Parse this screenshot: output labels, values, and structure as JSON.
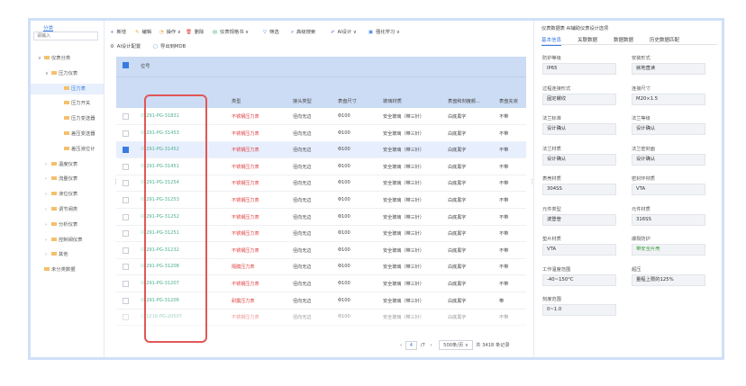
{
  "tree": {
    "title": "分类",
    "search_placeholder": "请输入",
    "items": [
      {
        "arrow": "∨",
        "label": "仪表分类"
      },
      {
        "arrow": "∨",
        "label": "压力仪表"
      },
      {
        "arrow": "",
        "label": "压力表"
      },
      {
        "arrow": "",
        "label": "压力开关"
      },
      {
        "arrow": "",
        "label": "压力变送器"
      },
      {
        "arrow": "",
        "label": "差压变送器"
      },
      {
        "arrow": "",
        "label": "差压液位计"
      },
      {
        "arrow": "›",
        "label": "温度仪表"
      },
      {
        "arrow": "›",
        "label": "流量仪表"
      },
      {
        "arrow": "›",
        "label": "液位仪表"
      },
      {
        "arrow": "›",
        "label": "调节阀类"
      },
      {
        "arrow": "›",
        "label": "分析仪表"
      },
      {
        "arrow": "›",
        "label": "控制阀仪表"
      },
      {
        "arrow": "›",
        "label": "其他"
      },
      {
        "arrow": "",
        "label": "未分类数据"
      }
    ]
  },
  "toolbar": {
    "row1": [
      {
        "icon": "+",
        "label": "新增",
        "color": "#3a7be0"
      },
      {
        "icon": "✎",
        "label": "编辑",
        "color": "#f0a020"
      },
      {
        "icon": "◔",
        "label": "操作 ∨",
        "color": "#f0a020"
      },
      {
        "icon": "🗑",
        "label": "删除",
        "color": "#e04040"
      },
      {
        "icon": "▤",
        "label": "仪表规格书 ∨",
        "color": "#3bb36b"
      },
      {
        "icon": "▽",
        "label": "筛选",
        "color": "#3a7be0"
      },
      {
        "icon": "⌕",
        "label": "高级搜索",
        "color": "#3a7be0"
      },
      {
        "icon": "✐",
        "label": "AI设计 ∨",
        "color": "#8a56e0"
      },
      {
        "icon": "▣",
        "label": "强化学习 ∨",
        "color": "#3a7be0"
      }
    ],
    "row2": [
      {
        "icon": "⚙",
        "label": "AI设计配置",
        "color": "#666"
      },
      {
        "icon": "▢",
        "label": "导出到MDB",
        "color": "#3a7be0"
      }
    ]
  },
  "table": {
    "headers": {
      "position": "位号",
      "type": "类型",
      "connection": "接头类型",
      "size": "表盘尺寸",
      "material": "玻璃材质",
      "dial": "表盘和刻度颜...",
      "case": "表盘充液"
    },
    "rows": [
      {
        "tag": "291-PG-31831",
        "type": "不锈钢压力表",
        "connection": "径向无边",
        "size": "Φ100",
        "material": "安全玻璃（带三针）",
        "dial": "白底黑字",
        "fill": "不带",
        "checked": false
      },
      {
        "tag": "291-PG-31453",
        "type": "不锈钢压力表",
        "connection": "径向无边",
        "size": "Φ100",
        "material": "安全玻璃（带三针）",
        "dial": "白底黑字",
        "fill": "不带",
        "checked": false
      },
      {
        "tag": "291-PG-31452",
        "type": "不锈钢压力表",
        "connection": "径向无边",
        "size": "Φ100",
        "material": "安全玻璃（带三针）",
        "dial": "白底黑字",
        "fill": "不带",
        "checked": true
      },
      {
        "tag": "291-PG-31451",
        "type": "不锈钢压力表",
        "connection": "径向无边",
        "size": "Φ100",
        "material": "安全玻璃（带三针）",
        "dial": "白底黑字",
        "fill": "不带",
        "checked": false
      },
      {
        "tag": "291-PG-31254",
        "type": "不锈钢压力表",
        "connection": "径向无边",
        "size": "Φ100",
        "material": "安全玻璃（带三针）",
        "dial": "白底黑字",
        "fill": "不带",
        "checked": false
      },
      {
        "tag": "291-PG-31253",
        "type": "不锈钢压力表",
        "connection": "径向无边",
        "size": "Φ100",
        "material": "安全玻璃（带三针）",
        "dial": "白底黑字",
        "fill": "不带",
        "checked": false
      },
      {
        "tag": "291-PG-31252",
        "type": "不锈钢压力表",
        "connection": "径向无边",
        "size": "Φ100",
        "material": "安全玻璃（带三针）",
        "dial": "白底黑字",
        "fill": "不带",
        "checked": false
      },
      {
        "tag": "291-PG-31251",
        "type": "不锈钢压力表",
        "connection": "径向无边",
        "size": "Φ100",
        "material": "安全玻璃（带三针）",
        "dial": "白底黑字",
        "fill": "不带",
        "checked": false
      },
      {
        "tag": "291-PG-31232",
        "type": "不锈钢压力表",
        "connection": "径向无边",
        "size": "Φ100",
        "material": "安全玻璃（带三针）",
        "dial": "白底黑字",
        "fill": "不带",
        "checked": false
      },
      {
        "tag": "291-PG-31208",
        "type": "隔膜压力表",
        "connection": "径向无边",
        "size": "Φ100",
        "material": "安全玻璃（带三针）",
        "dial": "白底黑字",
        "fill": "不带",
        "checked": false
      },
      {
        "tag": "291-PG-31207",
        "type": "不锈钢压力表",
        "connection": "径向无边",
        "size": "Φ100",
        "material": "安全玻璃（带三针）",
        "dial": "白底黑字",
        "fill": "不带",
        "checked": false
      },
      {
        "tag": "291-PG-31206",
        "type": "耐震压力表",
        "connection": "径向无边",
        "size": "Φ100",
        "material": "安全玻璃（带三针）",
        "dial": "白底黑字",
        "fill": "带",
        "checked": false
      },
      {
        "tag": "1216-PG-20507",
        "type": "不锈钢压力表",
        "connection": "径向无边",
        "size": "Φ100",
        "material": "安全玻璃（带三针）",
        "dial": "白底黑字",
        "fill": "不带",
        "checked": false
      }
    ]
  },
  "pager": {
    "prev": "‹",
    "page": "4",
    "total_pages": "/7",
    "next": "›",
    "page_size": "500条/页 ∨",
    "total": "共 3418 条记录"
  },
  "right": {
    "header": "仪表数据表 AI辅助仪表设计选项",
    "tabs": [
      "基本信息",
      "关联数据",
      "数据数据",
      "历史数据匹配"
    ],
    "fields": [
      {
        "label": "防护等级",
        "value": "IP65"
      },
      {
        "label": "安装形式",
        "value": "就地直读"
      },
      {
        "label": "过程连接形式",
        "value": "固定螺纹"
      },
      {
        "label": "连接尺寸",
        "value": "M20×1.5"
      },
      {
        "label": "法兰标准",
        "value": "设计确认"
      },
      {
        "label": "法兰等级",
        "value": "设计确认"
      },
      {
        "label": "法兰材质",
        "value": "设计确认"
      },
      {
        "label": "法兰密封面",
        "value": "设计确认"
      },
      {
        "label": "表壳材质",
        "value": "304SS"
      },
      {
        "label": "密封环材质",
        "value": "VTA"
      },
      {
        "label": "元件类型",
        "value": "波登管"
      },
      {
        "label": "元件材质",
        "value": "316SS"
      },
      {
        "label": "垫片材质",
        "value": "VTA"
      },
      {
        "label": "爆裂防护",
        "value": "带安全片壳"
      },
      {
        "label": "工作温度范围",
        "value": "-40~150°C"
      },
      {
        "label": "超压",
        "value": "量程上限的125%"
      },
      {
        "label": "刻度范围",
        "value": "0~1.0"
      }
    ]
  }
}
